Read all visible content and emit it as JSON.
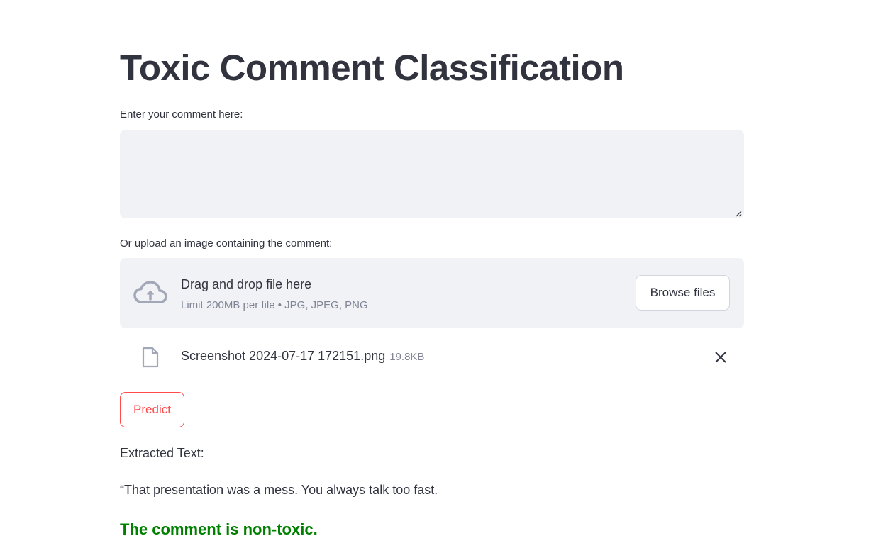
{
  "page": {
    "title": "Toxic Comment Classification"
  },
  "comment_input": {
    "label": "Enter your comment here:",
    "value": "",
    "placeholder": ""
  },
  "uploader": {
    "label": "Or upload an image containing the comment:",
    "dropzone_title": "Drag and drop file here",
    "dropzone_subtitle": "Limit 200MB per file • JPG, JPEG, PNG",
    "browse_label": "Browse files",
    "icon": "cloud-upload-icon"
  },
  "uploaded_file": {
    "name": "Screenshot 2024-07-17 172151.png",
    "size": "19.8KB",
    "icon": "file-icon",
    "remove_icon": "close-icon"
  },
  "actions": {
    "predict_label": "Predict"
  },
  "output": {
    "extracted_label": "Extracted Text:",
    "extracted_text": "“That presentation was a mess. You always talk too fast.",
    "result": "The comment is non-toxic."
  },
  "colors": {
    "text": "#31333f",
    "muted": "#808495",
    "input_bg": "#f0f2f6",
    "accent": "#ff4b4b",
    "success": "#008000"
  }
}
